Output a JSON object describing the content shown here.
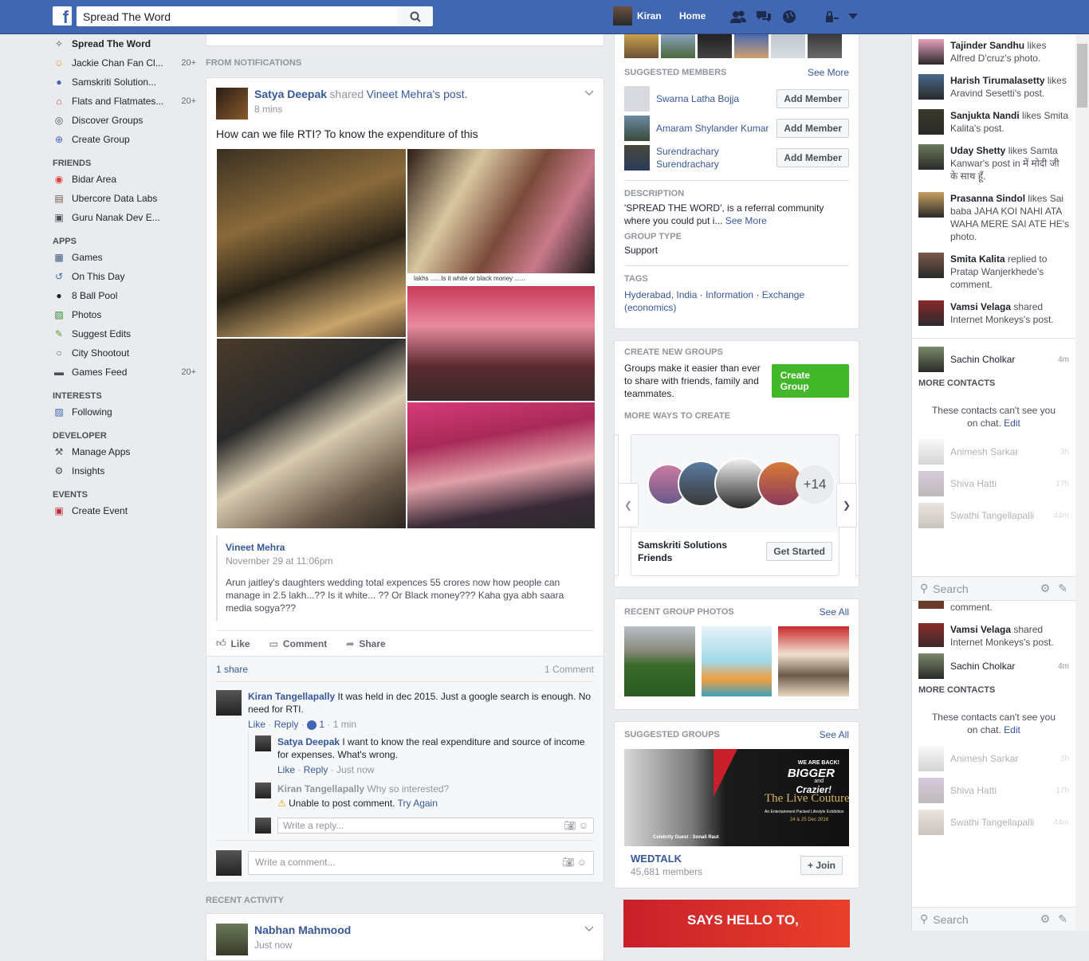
{
  "topbar": {
    "logo": "f",
    "search_value": "Spread The Word",
    "user_name": "Kiran",
    "home_label": "Home"
  },
  "leftnav": {
    "groups": [
      {
        "label": "Spread The Word",
        "count": "",
        "icon": "group-pin-icon",
        "bold": true
      },
      {
        "label": "Jackie Chan Fan Cl...",
        "count": "20+",
        "icon": "group-avatar-icon"
      },
      {
        "label": "Samskriti Solution...",
        "count": "",
        "icon": "group-people-icon"
      },
      {
        "label": "Flats and Flatmates...",
        "count": "20+",
        "icon": "house-icon"
      },
      {
        "label": "Discover Groups",
        "count": "",
        "icon": "compass-icon"
      },
      {
        "label": "Create Group",
        "count": "",
        "icon": "plus-circle-icon"
      }
    ],
    "friends_header": "FRIENDS",
    "friends": [
      {
        "label": "Bidar Area",
        "icon": "map-pin-icon"
      },
      {
        "label": "Ubercore Data Labs",
        "icon": "building-icon"
      },
      {
        "label": "Guru Nanak Dev E...",
        "icon": "graduation-icon"
      }
    ],
    "apps_header": "APPS",
    "apps": [
      {
        "label": "Games",
        "count": "",
        "icon": "games-grid-icon"
      },
      {
        "label": "On This Day",
        "count": "",
        "icon": "clock-rewind-icon"
      },
      {
        "label": "8 Ball Pool",
        "count": "",
        "icon": "pool-ball-icon"
      },
      {
        "label": "Photos",
        "count": "",
        "icon": "photos-icon"
      },
      {
        "label": "Suggest Edits",
        "count": "",
        "icon": "pencil-icon"
      },
      {
        "label": "City Shootout",
        "count": "",
        "icon": "circle-icon"
      },
      {
        "label": "Games Feed",
        "count": "20+",
        "icon": "gamepad-icon"
      }
    ],
    "interests_header": "INTERESTS",
    "interests": [
      {
        "label": "Following",
        "icon": "rss-icon"
      }
    ],
    "developer_header": "DEVELOPER",
    "developer": [
      {
        "label": "Manage Apps",
        "icon": "wrench-icon"
      },
      {
        "label": "Insights",
        "icon": "insights-icon"
      }
    ],
    "events_header": "EVENTS",
    "events": [
      {
        "label": "Create Event",
        "icon": "calendar-plus-icon"
      }
    ]
  },
  "feed": {
    "section_header": "FROM NOTIFICATIONS",
    "post": {
      "author": "Satya Deepak",
      "shared_text": "shared",
      "shared_from": "Vineet Mehra",
      "shared_suffix": "'s post.",
      "time": "8 mins",
      "text": "How can we file RTI? To know the expenditure of this",
      "photo_caption_strip": "lakhs ......Is it white or black money ......",
      "attachment": {
        "name": "Vineet Mehra",
        "date": "November 29 at 11:06pm",
        "text": "Arun jaitley's daughters wedding total expences 55 crores now how people can manage in 2.5 lakh...?? Is it white... ?? Or Black money??? Kaha gya abh saara media sogya???"
      },
      "actions": {
        "like": "Like",
        "comment": "Comment",
        "share": "Share"
      },
      "shares": "1 share",
      "comment_count": "1 Comment",
      "comments": [
        {
          "name": "Kiran Tangellapally",
          "text": "It was held in dec 2015. Just a google search is enough. No need for RTI.",
          "like": "Like",
          "reply": "Reply",
          "reactions": "1",
          "time": "1 min"
        }
      ],
      "replies": [
        {
          "name": "Satya Deepak",
          "text": "I want to know the real expenditure and source of income for expenses. What's wrong.",
          "like": "Like",
          "reply": "Reply",
          "time": "Just now"
        },
        {
          "name": "Kiran Tangellapally",
          "text": "Why so interested?",
          "error": "Unable to post comment.",
          "retry": "Try Again"
        }
      ],
      "reply_placeholder": "Write a reply...",
      "comment_placeholder": "Write a comment..."
    },
    "recent_header": "RECENT ACTIVITY",
    "recent_post": {
      "author": "Nabhan Mahmood",
      "time": "Just now"
    }
  },
  "right": {
    "suggested_members": {
      "header": "SUGGESTED MEMBERS",
      "see_more": "See More",
      "members": [
        {
          "name": "Swarna Latha Bojja",
          "button": "Add Member"
        },
        {
          "name": "Amaram Shylander Kumar",
          "button": "Add Member"
        },
        {
          "name": "Surendrachary Surendrachary",
          "button": "Add Member"
        }
      ]
    },
    "description_label": "DESCRIPTION",
    "description": "'SPREAD THE WORD', is a referral community where you could put i...",
    "description_more": "See More",
    "group_type_label": "GROUP TYPE",
    "group_type": "Support",
    "tags_label": "TAGS",
    "tags": [
      "Hyderabad, India",
      "Information",
      "Exchange (economics)"
    ],
    "create_groups": {
      "header": "CREATE NEW GROUPS",
      "text": "Groups make it easier than ever to share with friends, family and teammates.",
      "button": "Create Group",
      "more_ways": "MORE WAYS TO CREATE",
      "plus_count": "+14",
      "suggestion_name": "Samskriti Solutions Friends",
      "suggestion_button": "Get Started"
    },
    "recent_photos": {
      "header": "RECENT GROUP PHOTOS",
      "see_all": "See All"
    },
    "suggested_groups": {
      "header": "SUGGESTED GROUPS",
      "see_all": "See All",
      "banner_line1": "WE ARE BACK!",
      "banner_line2": "BIGGER",
      "banner_line3": "and",
      "banner_line4": "Crazier!",
      "banner_title": "The Live Couture",
      "banner_sub": "An Entertainment Packed Lifestyle Exhibition",
      "banner_dates": "24 & 25 Dec 2016",
      "banner_guest": "Celebrity Guest : Sonali Raut",
      "group_name": "WEDTALK",
      "members": "45,681 members",
      "join": "Join",
      "next_banner": "SAYS HELLO TO,"
    }
  },
  "chat": {
    "ticker": [
      {
        "name": "Tajinder Sandhu",
        "text": "likes Alfred D'cruz's photo."
      },
      {
        "name": "Harish Tirumalasetty",
        "text": "likes Aravind Sesetti's post."
      },
      {
        "name": "Sanjukta Nandi",
        "text": "likes Smita Kalita's post."
      },
      {
        "name": "Uday Shetty",
        "text": "likes Samta Kanwar's post in में मोदी जी के साथ हूँ."
      },
      {
        "name": "Prasanna Sindol",
        "text": "likes Sai baba JAHA KOI NAHI ATA WAHA MERE SAI ATE HE's photo."
      },
      {
        "name": "Smita Kalita",
        "text": "replied to Pratap Wanjerkhede's comment."
      },
      {
        "name": "Vamsi Velaga",
        "text": "shared Internet Monkeys's post."
      }
    ],
    "active": {
      "name": "Sachin Cholkar",
      "time": "4m"
    },
    "more_contacts": "MORE CONTACTS",
    "no_chat": "These contacts can't see you on chat.",
    "edit": "Edit",
    "contacts": [
      {
        "name": "Animesh Sarkar",
        "time": "3h"
      },
      {
        "name": "Shiva Hatti",
        "time": "17h"
      },
      {
        "name": "Swathi Tangellapalli",
        "time": "44m"
      }
    ],
    "search_placeholder": "Search",
    "dup_ticker": [
      {
        "name": "",
        "text": "comment."
      },
      {
        "name": "Vamsi Velaga",
        "text": "shared Internet Monkeys's post."
      }
    ]
  }
}
